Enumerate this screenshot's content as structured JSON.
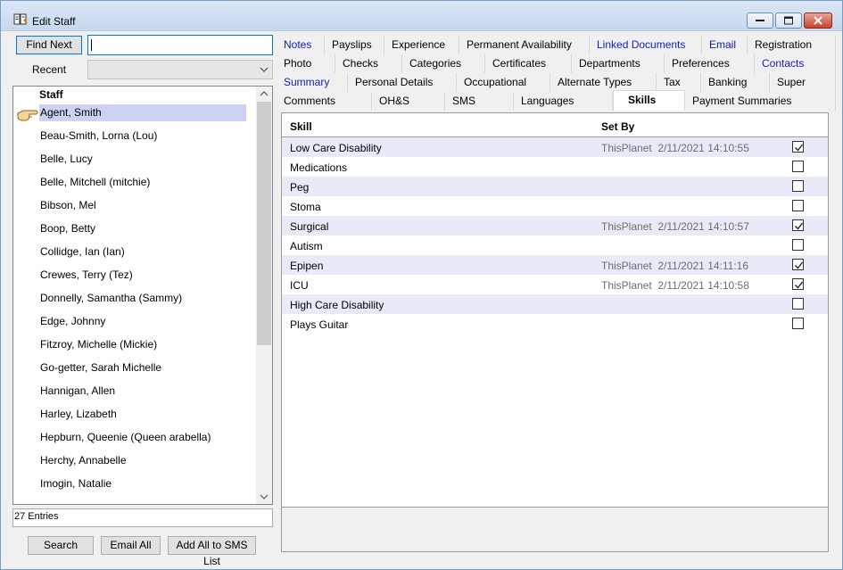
{
  "window": {
    "title": "Edit Staff",
    "app_icon": "book-edit-icon"
  },
  "search": {
    "find_next_label": "Find Next",
    "find_value": "",
    "recent_label": "Recent",
    "recent_value": ""
  },
  "staff": {
    "header": "Staff",
    "selected_index": 0,
    "items": [
      "Agent, Smith",
      "Beau-Smith, Lorna (Lou)",
      "Belle, Lucy",
      "Belle, Mitchell (mitchie)",
      "Bibson, Mel",
      "Boop, Betty",
      "Collidge, Ian (Ian)",
      "Crewes, Terry (Tez)",
      "Donnelly, Samantha (Sammy)",
      "Edge, Johnny",
      "Fitzroy, Michelle (Mickie)",
      "Go-getter, Sarah Michelle",
      "Hannigan, Allen",
      "Harley, Lizabeth",
      "Hepburn, Queenie (Queen arabella)",
      "Herchy, Annabelle",
      "Imogin, Natalie"
    ],
    "entries": "27 Entries"
  },
  "buttons": {
    "search": "Search",
    "email_all": "Email All",
    "add_all_sms": "Add All to SMS List"
  },
  "tabs": {
    "row1": [
      {
        "label": "Notes",
        "link": true
      },
      {
        "label": "Payslips",
        "link": false
      },
      {
        "label": "Experience",
        "link": false
      },
      {
        "label": "Permanent Availability",
        "link": false
      },
      {
        "label": "Linked Documents",
        "link": true
      },
      {
        "label": "Email",
        "link": true
      },
      {
        "label": "Registration",
        "link": false
      }
    ],
    "row2": [
      {
        "label": "Photo",
        "link": false
      },
      {
        "label": "Checks",
        "link": false
      },
      {
        "label": "Categories",
        "link": false
      },
      {
        "label": "Certificates",
        "link": false
      },
      {
        "label": "Departments",
        "link": false
      },
      {
        "label": "Preferences",
        "link": false
      },
      {
        "label": "Contacts",
        "link": true
      }
    ],
    "row3": [
      {
        "label": "Summary",
        "link": true
      },
      {
        "label": "Personal Details",
        "link": false
      },
      {
        "label": "Occupational",
        "link": false
      },
      {
        "label": "Alternate Types",
        "link": false
      },
      {
        "label": "Tax",
        "link": false
      },
      {
        "label": "Banking",
        "link": false
      },
      {
        "label": "Super",
        "link": false
      }
    ],
    "row4": [
      {
        "label": "Comments",
        "link": false
      },
      {
        "label": "OH&S",
        "link": false
      },
      {
        "label": "SMS",
        "link": false
      },
      {
        "label": "Languages",
        "link": false
      },
      {
        "label": "Skills",
        "link": false,
        "active": true
      },
      {
        "label": "Payment Summaries",
        "link": false
      }
    ]
  },
  "skills": {
    "col_skill": "Skill",
    "col_setby": "Set By",
    "rows": [
      {
        "skill": "Low Care Disability",
        "set_by": "ThisPlanet  2/11/2021 14:10:55",
        "checked": true
      },
      {
        "skill": "Medications",
        "set_by": "",
        "checked": false
      },
      {
        "skill": "Peg",
        "set_by": "",
        "checked": false
      },
      {
        "skill": "Stoma",
        "set_by": "",
        "checked": false
      },
      {
        "skill": "Surgical",
        "set_by": "ThisPlanet  2/11/2021 14:10:57",
        "checked": true
      },
      {
        "skill": "Autism",
        "set_by": "",
        "checked": false
      },
      {
        "skill": "Epipen",
        "set_by": "ThisPlanet  2/11/2021 14:11:16",
        "checked": true
      },
      {
        "skill": "ICU",
        "set_by": "ThisPlanet  2/11/2021 14:10:58",
        "checked": true
      },
      {
        "skill": "High Care Disability",
        "set_by": "",
        "checked": false
      },
      {
        "skill": "Plays Guitar",
        "set_by": "",
        "checked": false
      }
    ]
  },
  "colors": {
    "link": "#1a1ab5",
    "selected_row": "#cdd1f3",
    "alt_row": "#e9eaf8"
  }
}
